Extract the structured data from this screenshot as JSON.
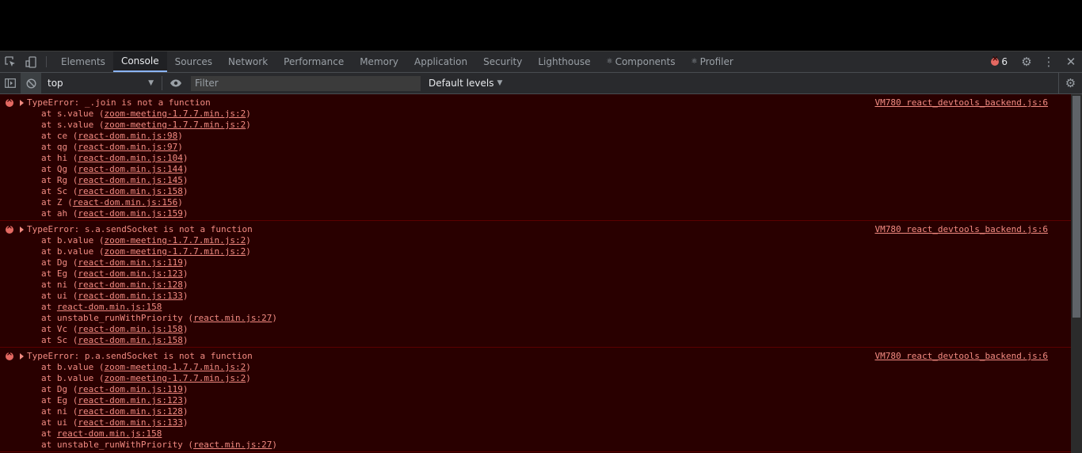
{
  "tabs": [
    {
      "label": "Elements",
      "active": false
    },
    {
      "label": "Console",
      "active": true
    },
    {
      "label": "Sources",
      "active": false
    },
    {
      "label": "Network",
      "active": false
    },
    {
      "label": "Performance",
      "active": false
    },
    {
      "label": "Memory",
      "active": false
    },
    {
      "label": "Application",
      "active": false
    },
    {
      "label": "Security",
      "active": false
    },
    {
      "label": "Lighthouse",
      "active": false
    },
    {
      "label": "Components",
      "active": false,
      "prefix_icon": "react-icon"
    },
    {
      "label": "Profiler",
      "active": false,
      "prefix_icon": "react-icon"
    }
  ],
  "tabbar": {
    "error_count": "6"
  },
  "toolbar": {
    "context": "top",
    "filter_placeholder": "Filter",
    "levels": "Default levels"
  },
  "messages": [
    {
      "level": "error",
      "text": "TypeError: _.join is not a function",
      "source": "VM780 react_devtools_backend.js:6",
      "frames": [
        {
          "prefix": "at s.value (",
          "link": "zoom-meeting-1.7.7.min.js:2",
          "suffix": ")"
        },
        {
          "prefix": "at s.value (",
          "link": "zoom-meeting-1.7.7.min.js:2",
          "suffix": ")"
        },
        {
          "prefix": "at ce (",
          "link": "react-dom.min.js:98",
          "suffix": ")"
        },
        {
          "prefix": "at qg (",
          "link": "react-dom.min.js:97",
          "suffix": ")"
        },
        {
          "prefix": "at hi (",
          "link": "react-dom.min.js:104",
          "suffix": ")"
        },
        {
          "prefix": "at Qg (",
          "link": "react-dom.min.js:144",
          "suffix": ")"
        },
        {
          "prefix": "at Rg (",
          "link": "react-dom.min.js:145",
          "suffix": ")"
        },
        {
          "prefix": "at Sc (",
          "link": "react-dom.min.js:158",
          "suffix": ")"
        },
        {
          "prefix": "at Z (",
          "link": "react-dom.min.js:156",
          "suffix": ")"
        },
        {
          "prefix": "at ah (",
          "link": "react-dom.min.js:159",
          "suffix": ")"
        }
      ]
    },
    {
      "level": "error",
      "text": "TypeError: s.a.sendSocket is not a function",
      "source": "VM780 react_devtools_backend.js:6",
      "frames": [
        {
          "prefix": "at b.value (",
          "link": "zoom-meeting-1.7.7.min.js:2",
          "suffix": ")"
        },
        {
          "prefix": "at b.value (",
          "link": "zoom-meeting-1.7.7.min.js:2",
          "suffix": ")"
        },
        {
          "prefix": "at Dg (",
          "link": "react-dom.min.js:119",
          "suffix": ")"
        },
        {
          "prefix": "at Eg (",
          "link": "react-dom.min.js:123",
          "suffix": ")"
        },
        {
          "prefix": "at ni (",
          "link": "react-dom.min.js:128",
          "suffix": ")"
        },
        {
          "prefix": "at ui (",
          "link": "react-dom.min.js:133",
          "suffix": ")"
        },
        {
          "prefix": "at ",
          "link": "react-dom.min.js:158",
          "suffix": ""
        },
        {
          "prefix": "at unstable_runWithPriority (",
          "link": "react.min.js:27",
          "suffix": ")"
        },
        {
          "prefix": "at Vc (",
          "link": "react-dom.min.js:158",
          "suffix": ")"
        },
        {
          "prefix": "at Sc (",
          "link": "react-dom.min.js:158",
          "suffix": ")"
        }
      ]
    },
    {
      "level": "error",
      "text": "TypeError: p.a.sendSocket is not a function",
      "source": "VM780 react_devtools_backend.js:6",
      "frames": [
        {
          "prefix": "at b.value (",
          "link": "zoom-meeting-1.7.7.min.js:2",
          "suffix": ")"
        },
        {
          "prefix": "at b.value (",
          "link": "zoom-meeting-1.7.7.min.js:2",
          "suffix": ")"
        },
        {
          "prefix": "at Dg (",
          "link": "react-dom.min.js:119",
          "suffix": ")"
        },
        {
          "prefix": "at Eg (",
          "link": "react-dom.min.js:123",
          "suffix": ")"
        },
        {
          "prefix": "at ni (",
          "link": "react-dom.min.js:128",
          "suffix": ")"
        },
        {
          "prefix": "at ui (",
          "link": "react-dom.min.js:133",
          "suffix": ")"
        },
        {
          "prefix": "at ",
          "link": "react-dom.min.js:158",
          "suffix": ""
        },
        {
          "prefix": "at unstable_runWithPriority (",
          "link": "react.min.js:27",
          "suffix": ")"
        }
      ]
    }
  ],
  "colors": {
    "error_text": "#f28b82",
    "error_bg": "#290000",
    "panel_bg": "#292a2d",
    "accent": "#8ab4f8"
  }
}
